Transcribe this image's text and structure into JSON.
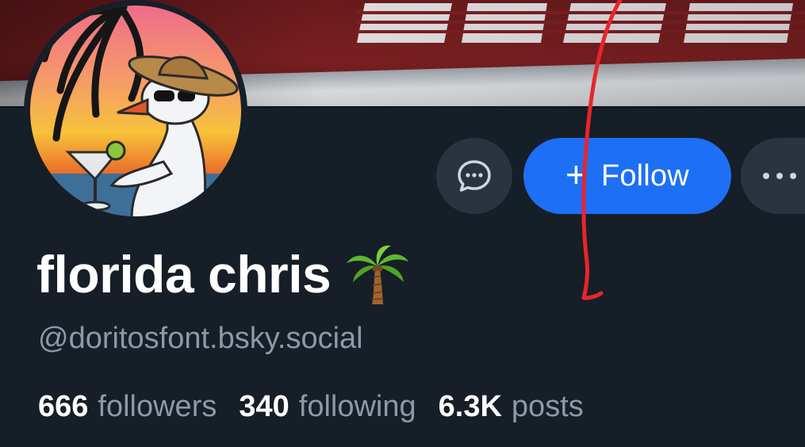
{
  "profile": {
    "display_name": "florida chris",
    "name_emoji": "palm-tree",
    "handle": "@doritosfont.bsky.social",
    "stats": [
      {
        "value": "666",
        "label": "followers"
      },
      {
        "value": "340",
        "label": "following"
      },
      {
        "value": "6.3K",
        "label": "posts"
      }
    ]
  },
  "actions": {
    "message_icon": "chat-bubble-icon",
    "follow_icon": "plus",
    "follow_label": "Follow",
    "more_icon": "ellipsis-icon"
  },
  "colors": {
    "background": "#161e27",
    "follow_button": "#1d6ff5",
    "secondary_button": "#2a3440",
    "muted_text": "#8d99a6",
    "annotation": "#e8252b"
  }
}
